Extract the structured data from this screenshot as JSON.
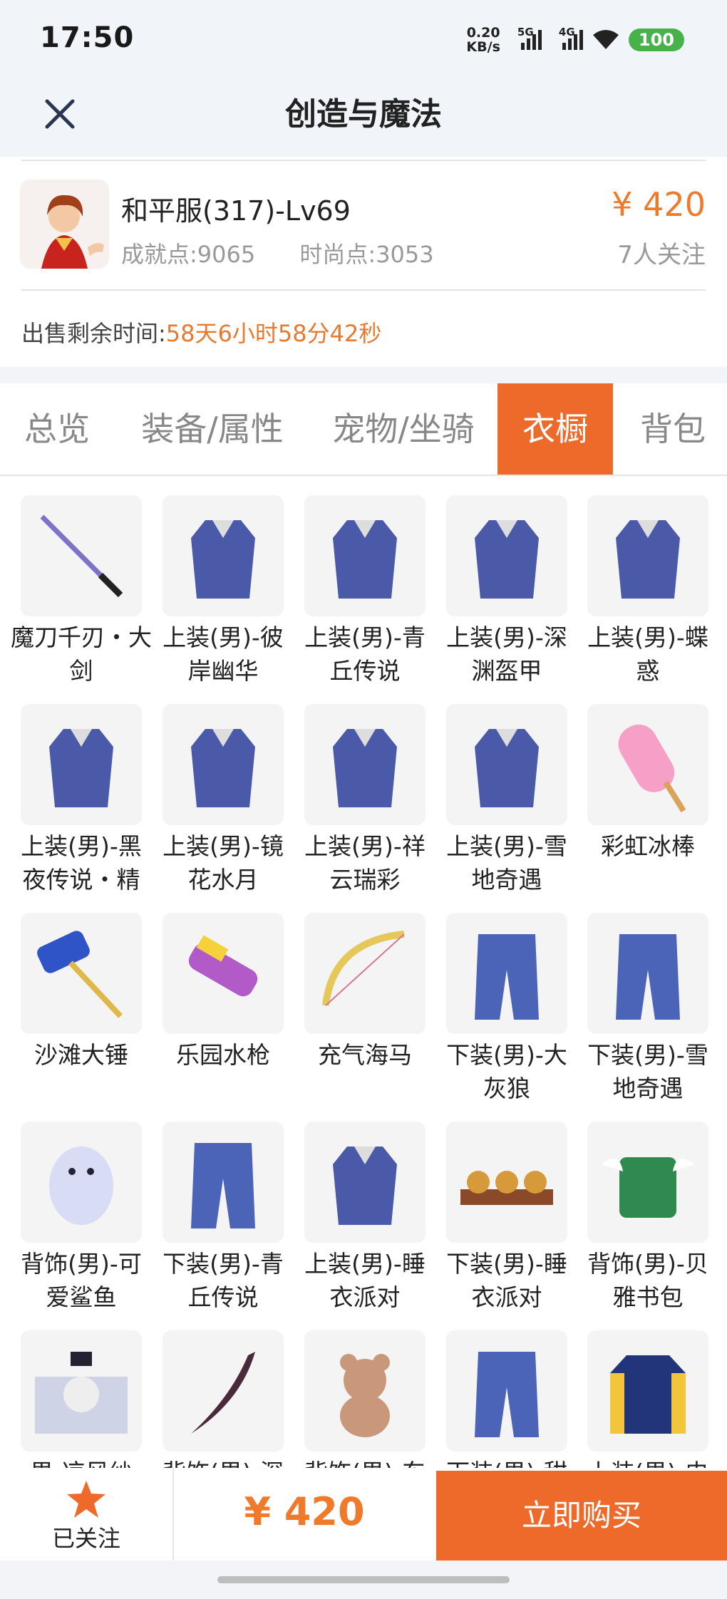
{
  "status_bar": {
    "time": "17:50",
    "speed": "0.20",
    "speed_unit": "KB/s",
    "net1": "5G",
    "net2": "4G",
    "battery": "100"
  },
  "nav": {
    "title": "创造与魔法"
  },
  "character": {
    "name": "和平服(317)-Lv69",
    "achievement": "成就点:9065",
    "fashion": "时尚点:3053",
    "price": "¥ 420",
    "followers": "7人关注",
    "sale_time_label": "出售剩余时间:",
    "sale_time_value": "58天6小时58分42秒"
  },
  "tabs": [
    "总览",
    "装备/属性",
    "宠物/坐骑",
    "衣橱",
    "背包"
  ],
  "active_tab": "衣橱",
  "items": [
    {
      "name": "魔刀千刃・大剑",
      "icon": "sword-icon"
    },
    {
      "name": "上装(男)-彼岸幽华",
      "icon": "costume-icon"
    },
    {
      "name": "上装(男)-青丘传说",
      "icon": "costume-icon"
    },
    {
      "name": "上装(男)-深渊盔甲",
      "icon": "costume-icon"
    },
    {
      "name": "上装(男)-蝶惑",
      "icon": "costume-icon"
    },
    {
      "name": "上装(男)-黑夜传说・精",
      "icon": "costume-icon"
    },
    {
      "name": "上装(男)-镜花水月",
      "icon": "costume-icon"
    },
    {
      "name": "上装(男)-祥云瑞彩",
      "icon": "costume-icon"
    },
    {
      "name": "上装(男)-雪地奇遇",
      "icon": "costume-icon"
    },
    {
      "name": "彩虹冰棒",
      "icon": "popsicle-icon"
    },
    {
      "name": "沙滩大锤",
      "icon": "hammer-icon"
    },
    {
      "name": "乐园水枪",
      "icon": "water-gun-icon"
    },
    {
      "name": "充气海马",
      "icon": "bow-icon"
    },
    {
      "name": "下装(男)-大灰狼",
      "icon": "pants-icon"
    },
    {
      "name": "下装(男)-雪地奇遇",
      "icon": "pants-icon"
    },
    {
      "name": "背饰(男)-可爱鲨鱼",
      "icon": "shark-icon"
    },
    {
      "name": "下装(男)-青丘传说",
      "icon": "pants-icon"
    },
    {
      "name": "上装(男)-睡衣派对",
      "icon": "costume-icon"
    },
    {
      "name": "下装(男)-睡衣派对",
      "icon": "slippers-icon"
    },
    {
      "name": "背饰(男)-贝雅书包",
      "icon": "backpack-icon"
    },
    {
      "name": "男-凉风纱",
      "icon": "hat-icon"
    },
    {
      "name": "背饰(男)-深",
      "icon": "blade-icon"
    },
    {
      "name": "背饰(男)-东",
      "icon": "teddy-bear-icon"
    },
    {
      "name": "下装(男)-甜",
      "icon": "pants-icon"
    },
    {
      "name": "上装(男)-史",
      "icon": "jacket-icon"
    }
  ],
  "bottom": {
    "follow_label": "已关注",
    "price": "¥ 420",
    "buy_label": "立即购买"
  },
  "colors": {
    "accent": "#ee6a2b",
    "price": "#f07a2b"
  }
}
